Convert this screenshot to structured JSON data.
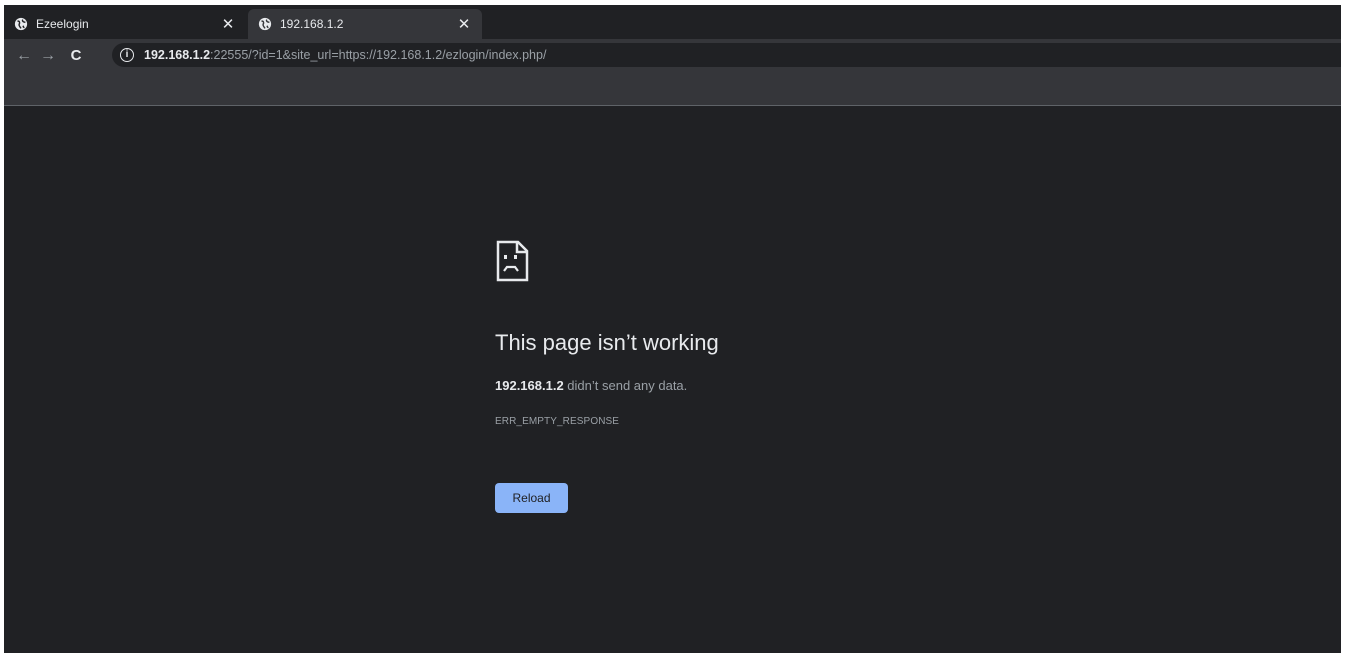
{
  "tabs": [
    {
      "title": "Ezeelogin",
      "icon": "globe-icon",
      "active": false
    },
    {
      "title": "192.168.1.2",
      "icon": "globe-icon",
      "active": true
    }
  ],
  "toolbar": {
    "back": "←",
    "forward": "→",
    "reload": "C",
    "info_symbol": "i",
    "url_host": "192.168.1.2",
    "url_rest": ":22555/?id=1&site_url=https://192.168.1.2/ezlogin/index.php/"
  },
  "error": {
    "title": "This page isn’t working",
    "host": "192.168.1.2",
    "message": " didn’t send any data.",
    "code": "ERR_EMPTY_RESPONSE",
    "reload_label": "Reload"
  },
  "colors": {
    "window_bg": "#202124",
    "toolbar_bg": "#35363a",
    "button_bg": "#8ab4f8",
    "text_primary": "#e8eaed",
    "text_secondary": "#9aa0a6"
  }
}
